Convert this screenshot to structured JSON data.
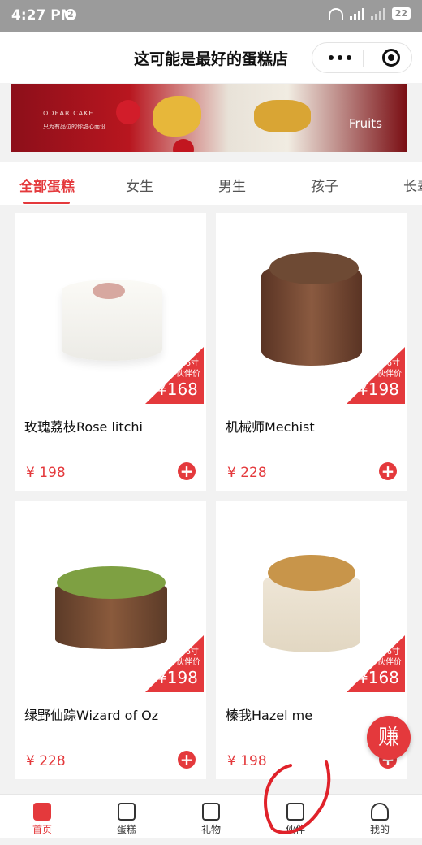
{
  "status_bar": {
    "time": "4:27 PM",
    "notification_count": "2",
    "battery": "22"
  },
  "nav": {
    "title": "这可能是最好的蛋糕店"
  },
  "banner": {
    "brand": "ODEAR CAKE",
    "slogan": "只为有品位的你甜心而设",
    "caption": "Fruits"
  },
  "category_tabs": [
    "全部蛋糕",
    "女生",
    "男生",
    "孩子",
    "长辈"
  ],
  "products": [
    {
      "name": "玫瑰荔枝Rose litchi",
      "price": "¥ 198",
      "ribbon_size": "6寸",
      "ribbon_tag": "伙伴价",
      "ribbon_price": "¥168"
    },
    {
      "name": "机械师Mechist",
      "price": "¥ 228",
      "ribbon_size": "6寸",
      "ribbon_tag": "伙伴价",
      "ribbon_price": "¥198"
    },
    {
      "name": "绿野仙踪Wizard of Oz",
      "price": "¥ 228",
      "ribbon_size": "6寸",
      "ribbon_tag": "伙伴价",
      "ribbon_price": "¥198"
    },
    {
      "name": "榛我Hazel me",
      "price": "¥ 198",
      "ribbon_size": "6寸",
      "ribbon_tag": "伙伴价",
      "ribbon_price": "¥168"
    }
  ],
  "add_symbol": "+",
  "earn_button": "赚",
  "tab_bar": [
    {
      "label": "首页",
      "icon": "home-cake-icon"
    },
    {
      "label": "蛋糕",
      "icon": "cake-box-icon"
    },
    {
      "label": "礼物",
      "icon": "gift-icon"
    },
    {
      "label": "伙伴",
      "icon": "vip-card-icon"
    },
    {
      "label": "我的",
      "icon": "person-icon"
    }
  ],
  "colors": {
    "accent": "#e4393c",
    "status_bar": "#9b9b9b"
  }
}
